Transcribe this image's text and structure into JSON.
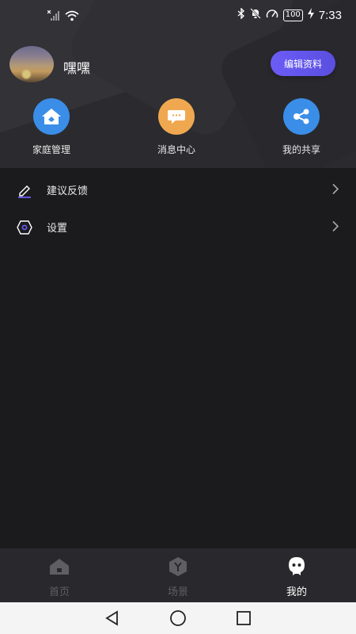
{
  "status_bar": {
    "time": "7:33",
    "battery": "100",
    "icons": [
      "no-signal-icon",
      "wifi-icon",
      "bluetooth-icon",
      "mute-icon",
      "speed-icon",
      "battery-icon",
      "charging-icon"
    ]
  },
  "profile": {
    "username": "嘿嘿",
    "edit_label": "编辑资料"
  },
  "quick_actions": [
    {
      "label": "家庭管理",
      "icon": "home-icon",
      "color": "#3a8ee8"
    },
    {
      "label": "消息中心",
      "icon": "message-icon",
      "color": "#f0a850"
    },
    {
      "label": "我的共享",
      "icon": "share-icon",
      "color": "#3a8ee8"
    }
  ],
  "menu": [
    {
      "label": "建议反馈",
      "icon": "pencil-icon"
    },
    {
      "label": "设置",
      "icon": "settings-hexagon-icon"
    }
  ],
  "tabs": [
    {
      "label": "首页",
      "icon": "home-icon",
      "active": false
    },
    {
      "label": "场景",
      "icon": "scene-icon",
      "active": false
    },
    {
      "label": "我的",
      "icon": "profile-icon",
      "active": true
    }
  ],
  "navigation": {
    "buttons": [
      "back-icon",
      "home-circle-icon",
      "recents-icon"
    ]
  },
  "colors": {
    "accent": "#6b5cf6",
    "background": "#1b1b1e",
    "tab_bar": "#29292d"
  }
}
